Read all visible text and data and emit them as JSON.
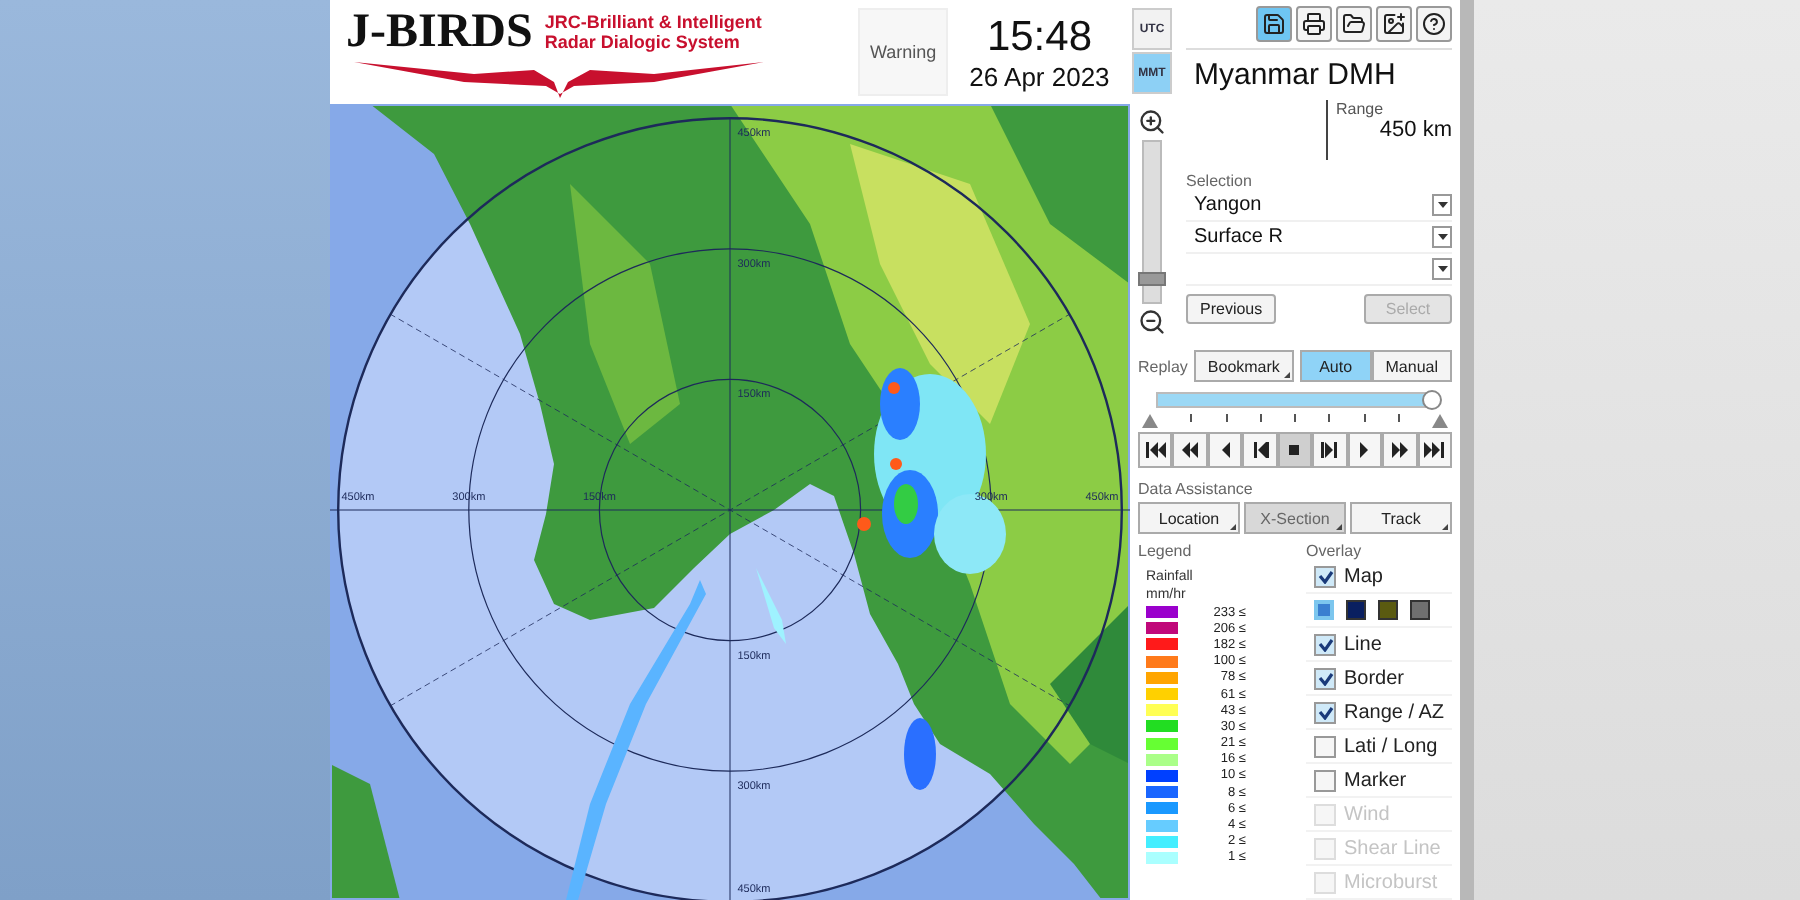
{
  "header": {
    "logo": {
      "title": "J-BIRDS",
      "subtitle_lines": [
        "JRC-Brilliant & Intelligent",
        "Radar Dialogic System"
      ]
    },
    "warning": "Warning",
    "time": "15:48",
    "date": "26 Apr 2023",
    "timezones": [
      {
        "label": "UTC",
        "selected": false
      },
      {
        "label": "MMT",
        "selected": true
      }
    ]
  },
  "map": {
    "range_labels": [
      "450km",
      "300km",
      "150km",
      "450km",
      "300km",
      "150km",
      "300km",
      "450km",
      "150km",
      "300km",
      "450km"
    ]
  },
  "zoom": {
    "level": 0.12
  },
  "panel": {
    "toolbar": [
      {
        "kind": "save",
        "selected": true
      },
      {
        "kind": "print",
        "selected": false
      },
      {
        "kind": "open",
        "selected": false
      },
      {
        "kind": "add-image",
        "selected": false
      },
      {
        "kind": "help",
        "selected": false
      }
    ],
    "station": "Myanmar DMH",
    "range": {
      "label": "Range",
      "value": "450 km"
    },
    "selection": {
      "label": "Selection",
      "dropdowns": [
        {
          "kind": "filled",
          "value": "Yangon"
        },
        {
          "kind": "filled",
          "value": "Surface R"
        },
        {
          "kind": "blank"
        }
      ]
    },
    "buttons": [
      {
        "label": "Previous",
        "disabled": false
      },
      {
        "label": "Select",
        "disabled": true
      }
    ]
  },
  "replay": {
    "label": "Replay",
    "bookmark": "Bookmark",
    "modes": [
      {
        "label": "Auto",
        "selected": true
      },
      {
        "label": "Manual",
        "selected": false
      }
    ],
    "timeline": {
      "level": 1
    },
    "controls": [
      {
        "kind": "first",
        "selected": false
      },
      {
        "kind": "fast-back",
        "selected": false
      },
      {
        "kind": "back",
        "selected": false
      },
      {
        "kind": "step-back",
        "selected": false
      },
      {
        "kind": "stop",
        "selected": true
      },
      {
        "kind": "step-forward",
        "selected": false
      },
      {
        "kind": "play",
        "selected": false
      },
      {
        "kind": "fast-forward",
        "selected": false
      },
      {
        "kind": "last",
        "selected": false
      }
    ]
  },
  "data_assistance": {
    "label": "Data Assistance",
    "buttons": [
      {
        "label": "Location",
        "selected": false
      },
      {
        "label": "X-Section",
        "selected": true
      },
      {
        "label": "Track",
        "selected": false
      }
    ]
  },
  "legend": {
    "title": "Legend",
    "unit_lines": [
      "Rainfall",
      "mm/hr"
    ],
    "items": [
      {
        "value": "233 ≤",
        "color": "#9a00cc"
      },
      {
        "value": "206 ≤",
        "color": "#c0087a"
      },
      {
        "value": "182 ≤",
        "color": "#ff1a1a"
      },
      {
        "value": "100 ≤",
        "color": "#ff7a1a"
      },
      {
        "value": "78 ≤",
        "color": "#ffa500"
      },
      {
        "value": "61 ≤",
        "color": "#ffd000"
      },
      {
        "value": "43 ≤",
        "color": "#ffff55"
      },
      {
        "value": "30 ≤",
        "color": "#22dd22"
      },
      {
        "value": "21 ≤",
        "color": "#66ff33"
      },
      {
        "value": "16 ≤",
        "color": "#aaff88"
      },
      {
        "value": "10 ≤",
        "color": "#0040ff"
      },
      {
        "value": "8 ≤",
        "color": "#1a66ff"
      },
      {
        "value": "6 ≤",
        "color": "#1a99ff"
      },
      {
        "value": "4 ≤",
        "color": "#66ccff"
      },
      {
        "value": "2 ≤",
        "color": "#44eeff"
      },
      {
        "value": "1 ≤",
        "color": "#aaffff"
      }
    ]
  },
  "overlay": {
    "title": "Overlay",
    "items": [
      {
        "kind": "check",
        "label": "Map",
        "checked": true,
        "disabled": false
      },
      {
        "kind": "swatches",
        "swatches": [
          {
            "color": "#3a7fd0",
            "selected": true
          },
          {
            "color": "#0a1f60",
            "selected": false
          },
          {
            "color": "#5a5a10",
            "selected": false
          },
          {
            "color": "#707070",
            "selected": false
          }
        ]
      },
      {
        "kind": "check",
        "label": "Line",
        "checked": true,
        "disabled": false
      },
      {
        "kind": "check",
        "label": "Border",
        "checked": true,
        "disabled": false
      },
      {
        "kind": "check",
        "label": "Range / AZ",
        "checked": true,
        "disabled": false
      },
      {
        "kind": "check",
        "label": "Lati / Long",
        "checked": false,
        "disabled": false
      },
      {
        "kind": "check",
        "label": "Marker",
        "checked": false,
        "disabled": false
      },
      {
        "kind": "check",
        "label": "Wind",
        "checked": false,
        "disabled": true
      },
      {
        "kind": "check",
        "label": "Shear Line",
        "checked": false,
        "disabled": true
      },
      {
        "kind": "check",
        "label": "Microburst",
        "checked": false,
        "disabled": true
      }
    ]
  }
}
